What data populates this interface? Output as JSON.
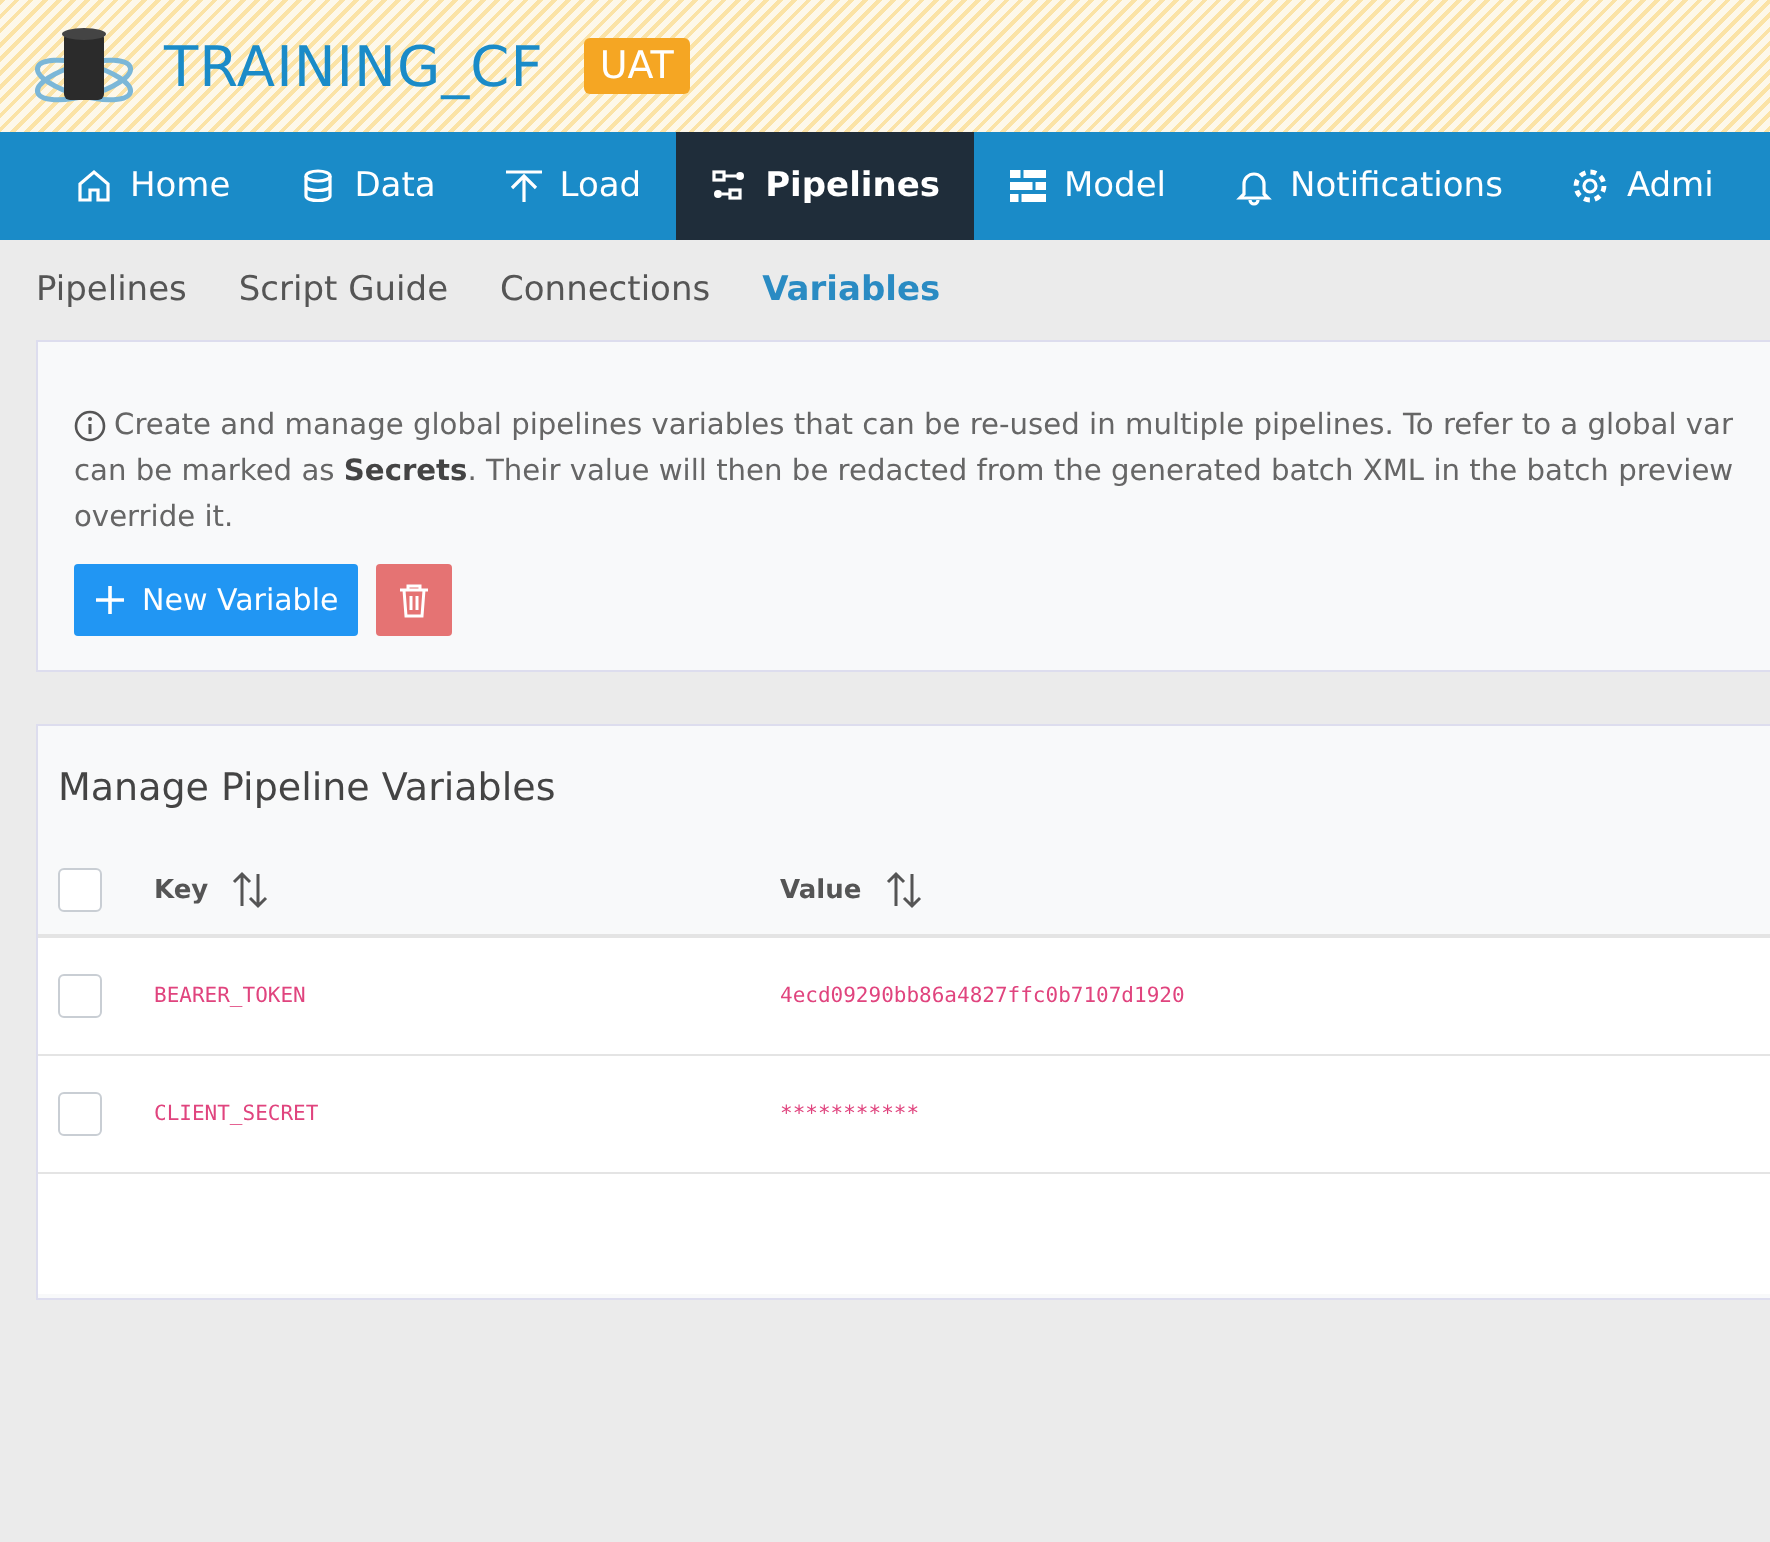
{
  "header": {
    "title": "TRAINING_CF",
    "badge": "UAT"
  },
  "nav": [
    {
      "label": "Home",
      "kind": "home",
      "selected": false
    },
    {
      "label": "Data",
      "kind": "data",
      "selected": false
    },
    {
      "label": "Load",
      "kind": "load",
      "selected": false
    },
    {
      "label": "Pipelines",
      "kind": "pipelines",
      "selected": true
    },
    {
      "label": "Model",
      "kind": "model",
      "selected": false
    },
    {
      "label": "Notifications",
      "kind": "notifications",
      "selected": false
    },
    {
      "label": "Admi",
      "kind": "admin",
      "selected": false
    }
  ],
  "subnav": [
    {
      "label": "Pipelines",
      "selected": false
    },
    {
      "label": "Script Guide",
      "selected": false
    },
    {
      "label": "Connections",
      "selected": false
    },
    {
      "label": "Variables",
      "selected": true
    }
  ],
  "info": {
    "lines": [
      "Create and manage global pipelines variables that can be re-used in multiple pipelines. To refer to a global var",
      "can be marked as **Secrets**. Their value will then be redacted from the generated batch XML in the batch preview",
      "override it."
    ]
  },
  "buttons": {
    "new": "New Variable"
  },
  "table": {
    "title": "Manage Pipeline Variables",
    "all_checked": false,
    "columns": [
      "Key",
      "Value"
    ],
    "rows": [
      {
        "key": "BEARER_TOKEN",
        "value": "4ecd09290bb86a4827ffc0b7107d1920",
        "checked": false
      },
      {
        "key": "CLIENT_SECRET",
        "value": "***********",
        "checked": false
      }
    ]
  }
}
